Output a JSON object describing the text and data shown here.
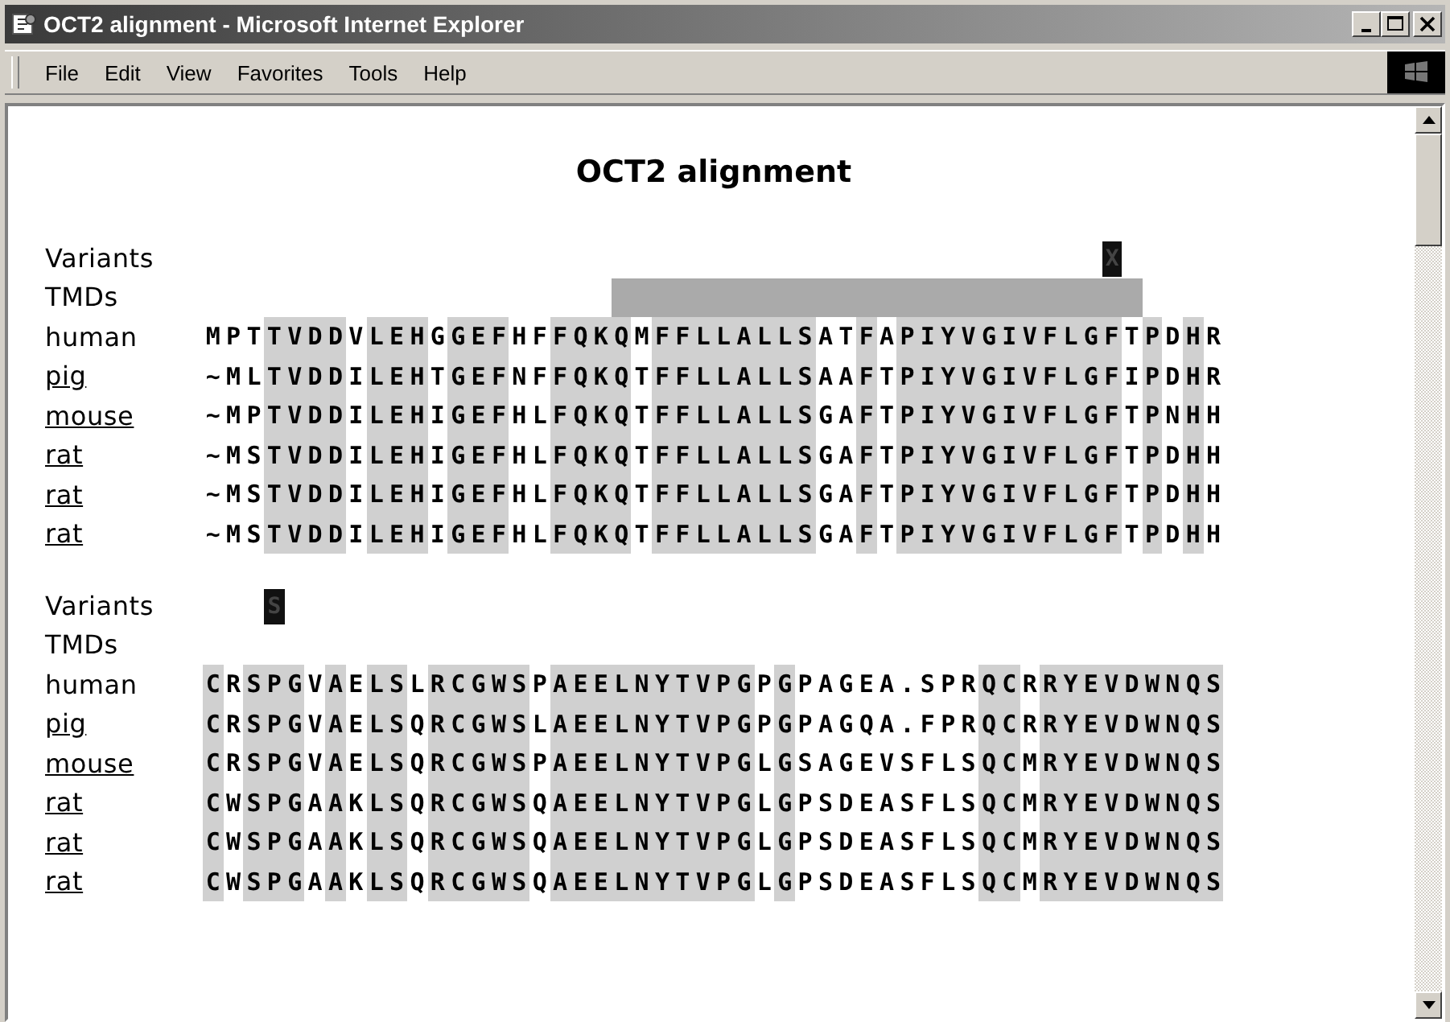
{
  "window": {
    "title": "OCT2 alignment - Microsoft Internet Explorer"
  },
  "menu": [
    "File",
    "Edit",
    "View",
    "Favorites",
    "Tools",
    "Help"
  ],
  "page_title": "OCT2 alignment",
  "blocks": [
    {
      "variants_label": "Variants",
      "tmds_label": "TMDs",
      "variants": "                                            X",
      "tmd": [
        false,
        false,
        false,
        false,
        false,
        false,
        false,
        false,
        false,
        false,
        false,
        false,
        false,
        false,
        false,
        false,
        false,
        false,
        false,
        false,
        true,
        true,
        true,
        true,
        true,
        true,
        true,
        true,
        true,
        true,
        true,
        true,
        true,
        true,
        true,
        true,
        true,
        true,
        true,
        true,
        true,
        true,
        true,
        true,
        true,
        true
      ],
      "rows": [
        {
          "species": "human",
          "link": false,
          "sequence": "MPTTVDDVLEHGGEFHFFQKQMFFLLALLSATFAPIYVGIVFLGFTPDHR"
        },
        {
          "species": "pig",
          "link": true,
          "sequence": "~MLTVDDILEHTGEFNFFQKQTFFLLALLSAAFTPIYVGIVFLGFIPDHR"
        },
        {
          "species": "mouse",
          "link": true,
          "sequence": "~MPTVDDILEHIGEFHLFQKQTFFLLALLSGAFTPIYVGIVFLGFTPNHH"
        },
        {
          "species": "rat",
          "link": true,
          "sequence": "~MSTVDDILEHIGEFHLFQKQTFFLLALLSGAFTPIYVGIVFLGFTPDHH"
        },
        {
          "species": "rat",
          "link": true,
          "sequence": "~MSTVDDILEHIGEFHLFQKQTFFLLALLSGAFTPIYVGIVFLGFTPDHH"
        },
        {
          "species": "rat",
          "link": true,
          "sequence": "~MSTVDDILEHIGEFHLFQKQTFFLLALLSGAFTPIYVGIVFLGFTPDHH"
        }
      ]
    },
    {
      "variants_label": "Variants",
      "tmds_label": "TMDs",
      "variants": "   S",
      "rows": [
        {
          "species": "human",
          "link": false,
          "sequence": "CRSPGVAELSLRCGWSPAEELNYTVPGPGPAGEA.SPRQCRRYEVDWNQS"
        },
        {
          "species": "pig",
          "link": true,
          "sequence": "CRSPGVAELSQRCGWSLAEELNYTVPGPGPAGQA.FPRQCRRYEVDWNQS"
        },
        {
          "species": "mouse",
          "link": true,
          "sequence": "CRSPGVAELSQRCGWSPAEELNYTVPGLGSAGEVSFLSQCMRYEVDWNQS"
        },
        {
          "species": "rat",
          "link": true,
          "sequence": "CWSPGAAKLSQRCGWSQAEELNYTVPGLGPSDEASFLSQCMRYEVDWNQS"
        },
        {
          "species": "rat",
          "link": true,
          "sequence": "CWSPGAAKLSQRCGWSQAEELNYTVPGLGPSDEASFLSQCMRYEVDWNQS"
        },
        {
          "species": "rat",
          "link": true,
          "sequence": "CWSPGAAKLSQRCGWSQAEELNYTVPGLGPSDEASFLSQCMRYEVDWNQS"
        }
      ]
    }
  ]
}
